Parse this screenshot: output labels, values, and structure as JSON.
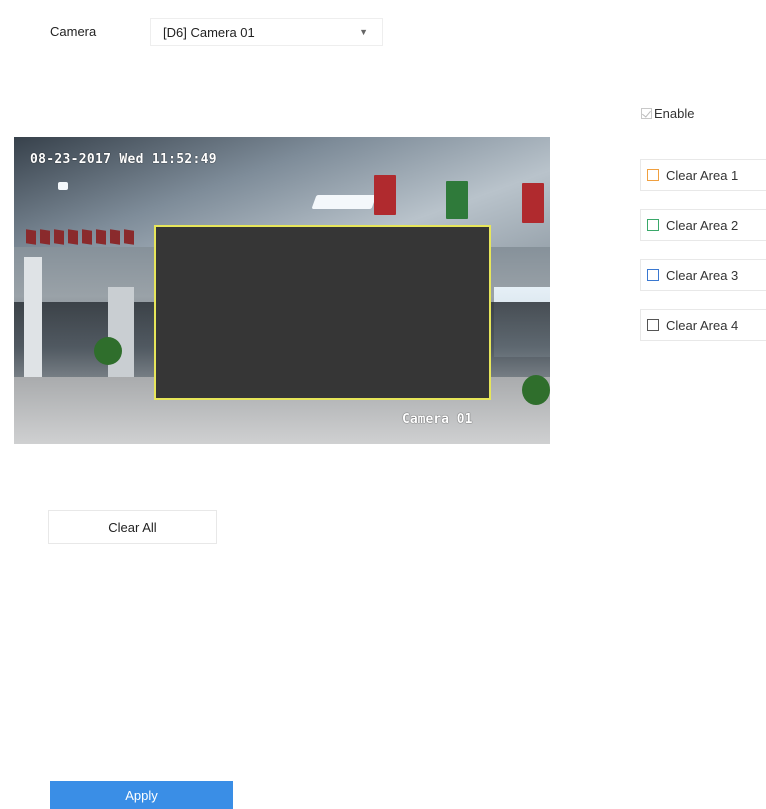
{
  "camera": {
    "label": "Camera",
    "selected": "[D6] Camera 01"
  },
  "video": {
    "osd_time": "08-23-2017 Wed 11:52:49",
    "osd_name": "Camera 01",
    "mask_color": "#e7e65a"
  },
  "enable": {
    "label": "Enable",
    "checked": true
  },
  "areas": [
    {
      "label": "Clear Area 1",
      "color": "#f0a040"
    },
    {
      "label": "Clear Area 2",
      "color": "#3aa86a"
    },
    {
      "label": "Clear Area 3",
      "color": "#3a78d0"
    },
    {
      "label": "Clear Area 4",
      "color": "#555555"
    }
  ],
  "buttons": {
    "clear_all": "Clear All",
    "apply": "Apply"
  },
  "colors": {
    "accent": "#3a8ee6"
  }
}
